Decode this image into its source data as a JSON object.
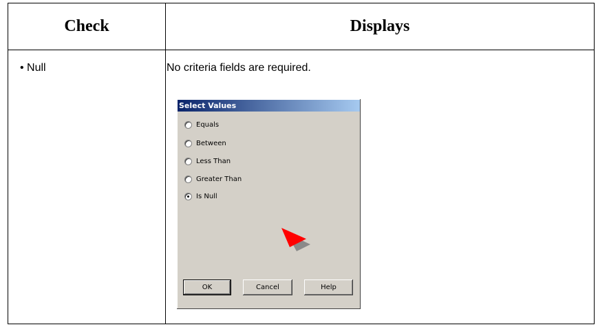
{
  "table": {
    "headers": {
      "check": "Check",
      "displays": "Displays"
    },
    "rows": [
      {
        "check": "• Null",
        "displays_text": "No criteria fields are required."
      }
    ]
  },
  "dialog": {
    "title": "Select Values",
    "options": [
      {
        "label": "Equals",
        "selected": false
      },
      {
        "label": "Between",
        "selected": false
      },
      {
        "label": "Less Than",
        "selected": false
      },
      {
        "label": "Greater Than",
        "selected": false
      },
      {
        "label": "Is Null",
        "selected": true
      }
    ],
    "buttons": {
      "ok": "OK",
      "cancel": "Cancel",
      "help": "Help"
    },
    "colors": {
      "titlebar_start": "#0a246a",
      "titlebar_end": "#a6caf0",
      "face": "#d4d0c8",
      "pointer": "#ff0000"
    }
  }
}
